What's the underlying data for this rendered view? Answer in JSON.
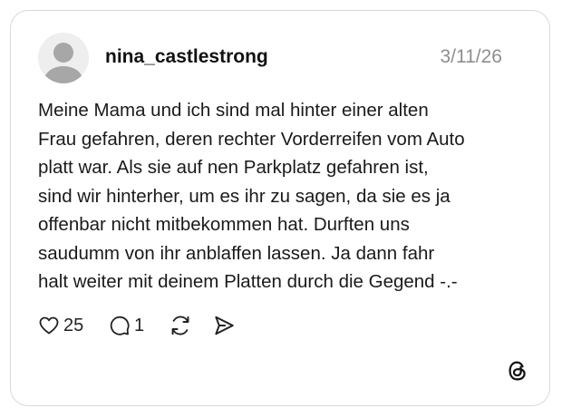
{
  "post": {
    "username": "nina_castlestrong",
    "date": "3/11/26",
    "lines": [
      "Meine Mama und ich sind mal hinter einer alten",
      "Frau gefahren, deren rechter Vorderreifen vom Auto",
      "platt war. Als sie auf nen Parkplatz gefahren ist,",
      "sind wir hinterher, um es ihr zu sagen, da sie es ja",
      "offenbar nicht mitbekommen hat. Durften uns",
      "saudumm von ihr anblaffen lassen. Ja dann fahr",
      "halt weiter mit deinem Platten durch die Gegend -.-"
    ],
    "likes": "25",
    "replies": "1"
  },
  "icons": {
    "avatar": "default-avatar-icon",
    "like": "heart-icon",
    "reply": "comment-bubble-icon",
    "repost": "repost-icon",
    "share": "send-icon",
    "brand": "threads-logo-icon"
  },
  "colors": {
    "text": "#1a1a1a",
    "muted": "#8e8e8e",
    "border": "#d9d9d9"
  }
}
